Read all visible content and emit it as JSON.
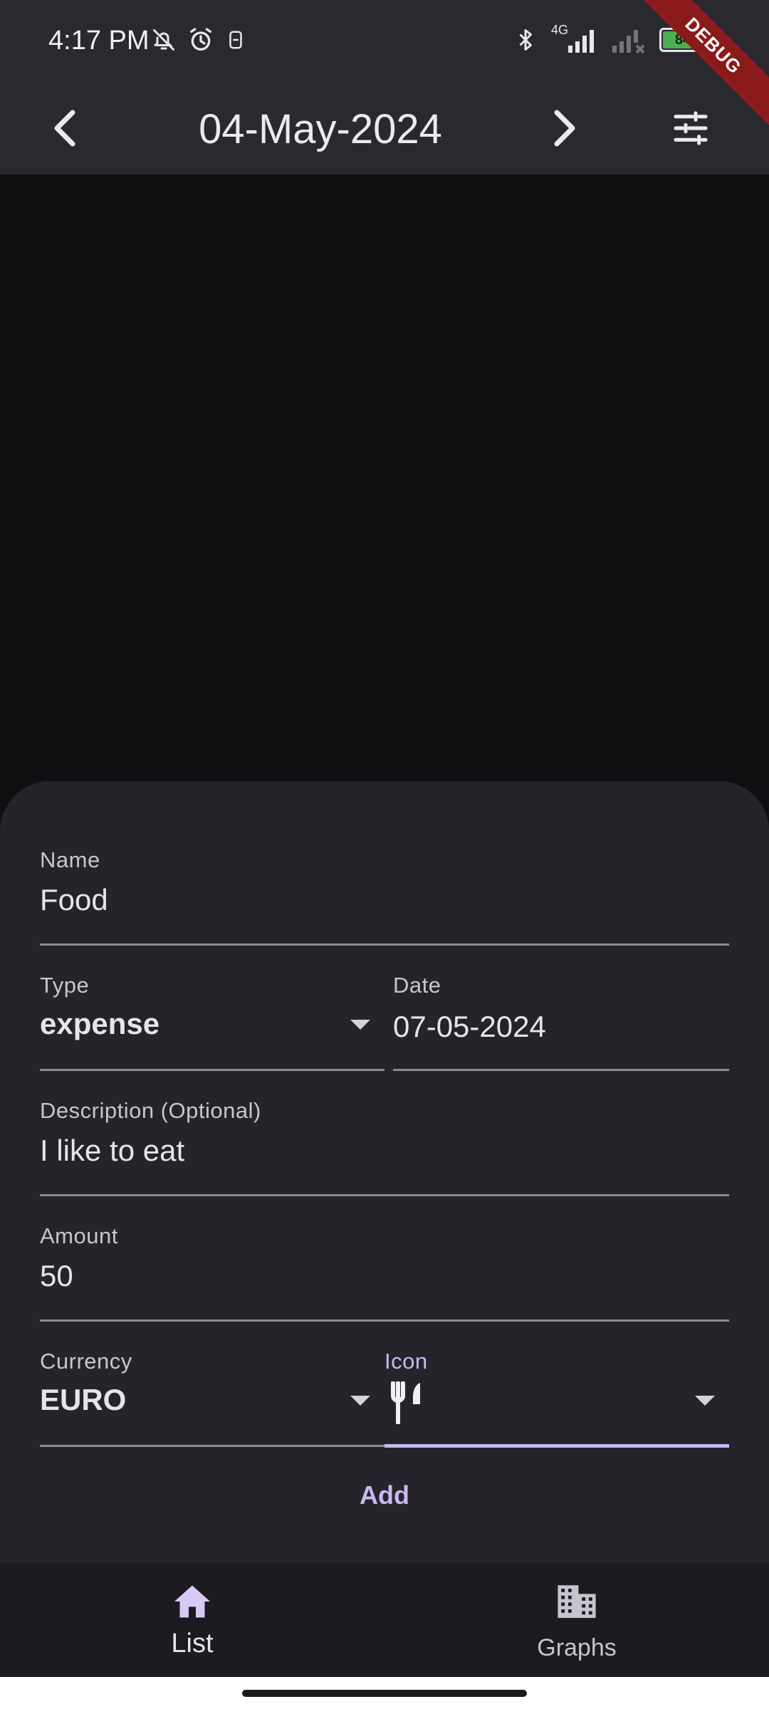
{
  "status_bar": {
    "time": "4:17 PM",
    "network": "4G",
    "battery": "84",
    "left_icons": [
      "bell-off-icon",
      "alarm-icon",
      "sim-icon"
    ],
    "right_icons": [
      "bluetooth-icon",
      "signal-icon",
      "signal-no-service-icon"
    ]
  },
  "debug_banner": "DEBUG",
  "app_bar": {
    "title": "04-May-2024",
    "prev_icon": "chevron-left-icon",
    "next_icon": "chevron-right-icon",
    "filter_icon": "tune-icon"
  },
  "form": {
    "name": {
      "label": "Name",
      "value": "Food"
    },
    "type": {
      "label": "Type",
      "value": "expense"
    },
    "date": {
      "label": "Date",
      "value": "07-05-2024"
    },
    "description": {
      "label": "Description (Optional)",
      "value": "I like to eat"
    },
    "amount": {
      "label": "Amount",
      "value": "50"
    },
    "currency": {
      "label": "Currency",
      "value": "EURO"
    },
    "icon": {
      "label": "Icon",
      "value_icon": "restaurant-icon"
    },
    "add_label": "Add"
  },
  "bottom_nav": {
    "items": [
      {
        "label": "List",
        "icon": "home-icon",
        "selected": true
      },
      {
        "label": "Graphs",
        "icon": "building-icon",
        "selected": false
      }
    ]
  },
  "colors": {
    "accent": "#cbb8f2",
    "app_bar": "#2a2930",
    "sheet": "#25242b",
    "background": "#0f0f12"
  }
}
